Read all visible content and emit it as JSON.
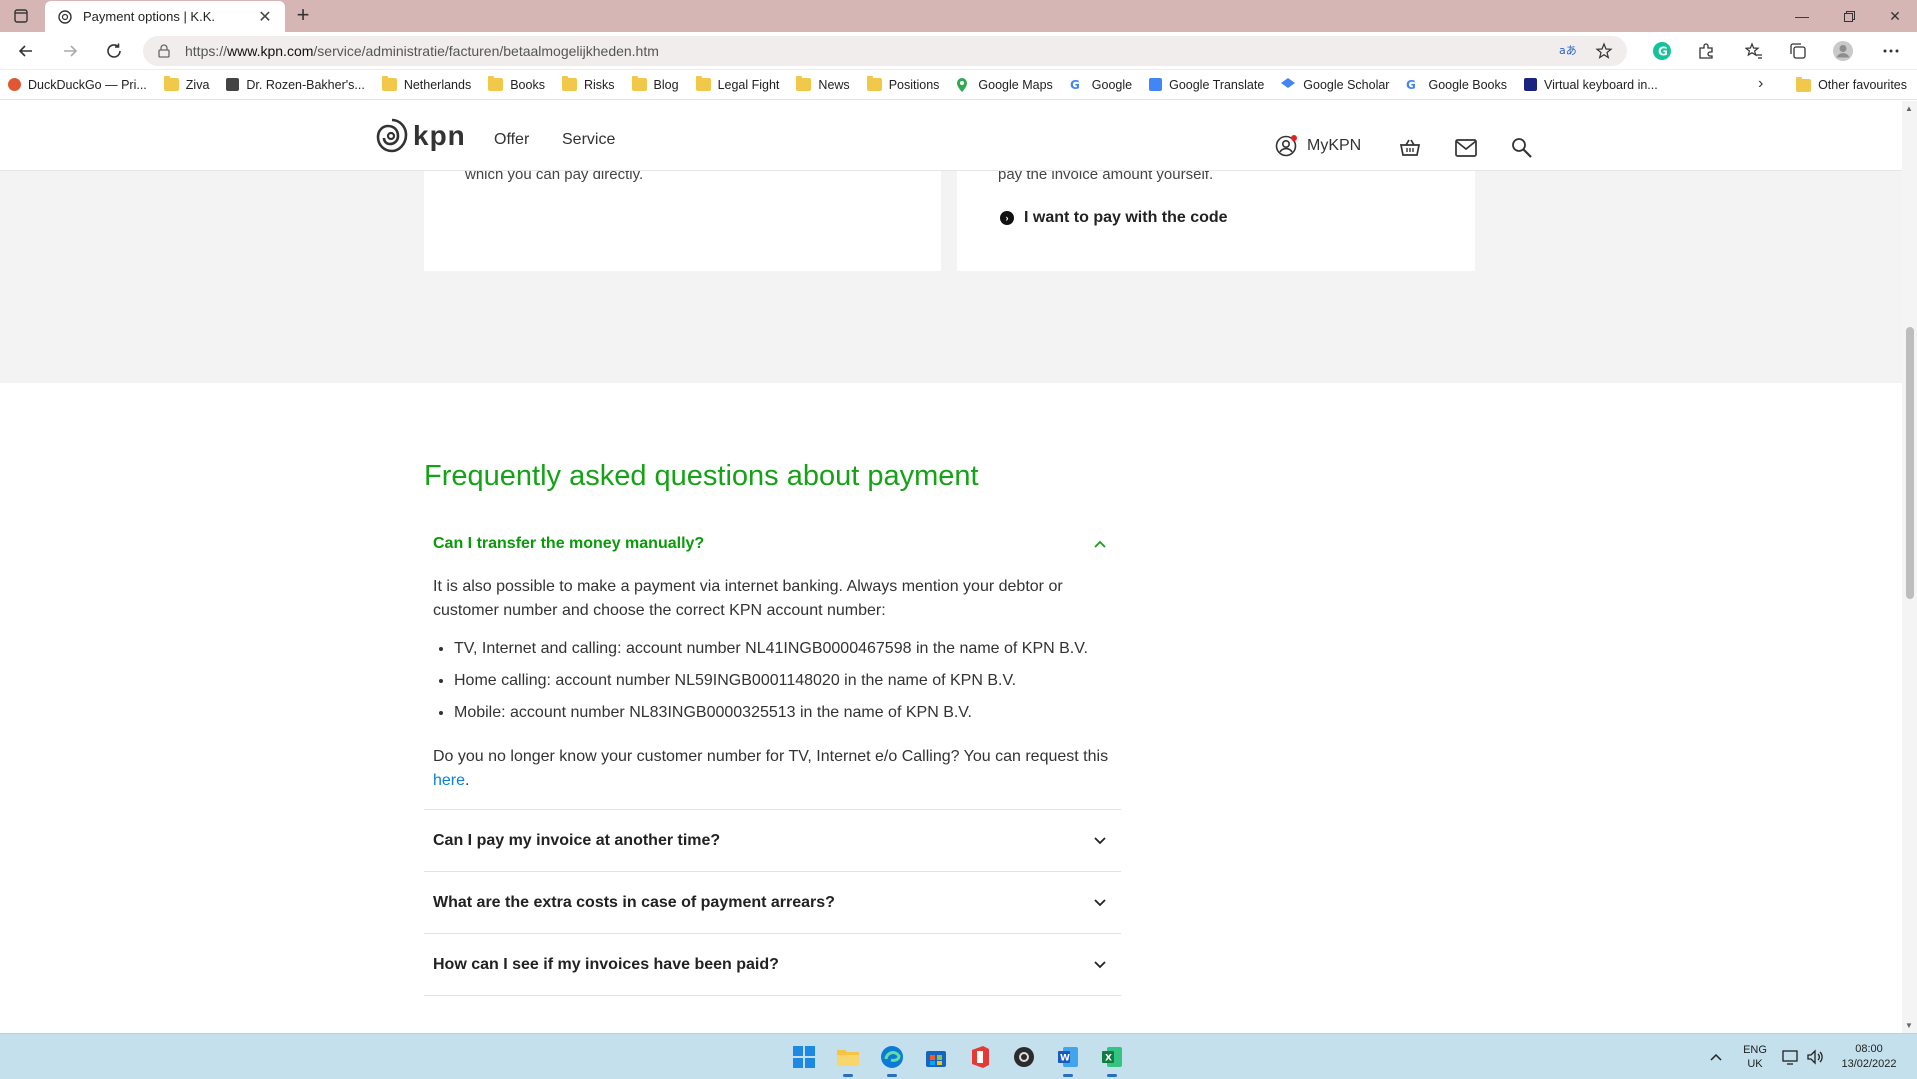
{
  "browser": {
    "tab_title": "Payment options | K.K.",
    "url_prefix": "https://",
    "url_domain": "www.kpn.com",
    "url_path": "/service/administratie/facturen/betaalmogelijkheden.htm",
    "favorites": [
      "DuckDuckGo — Pri...",
      "Ziva",
      "Dr. Rozen-Bakher's...",
      "Netherlands",
      "Books",
      "Risks",
      "Blog",
      "Legal Fight",
      "News",
      "Positions",
      "Google Maps",
      "Google",
      "Google Translate",
      "Google Scholar",
      "Google Books",
      "Virtual keyboard in..."
    ],
    "other_favourites": "Other favourites"
  },
  "site": {
    "logo_text": "kpn",
    "nav": [
      "Offer",
      "Service"
    ],
    "mykpn": "MyKPN"
  },
  "cards": {
    "left_partial_text": "which you can pay directly.",
    "right_partial_text": "pay the invoice amount yourself.",
    "pay_code_link": "I want to pay with the code"
  },
  "faq": {
    "title": "Frequently asked questions about payment",
    "open_question": "Can I transfer the money manually?",
    "answer_intro": "It is also possible to make a payment via internet banking. Always mention your debtor or customer number and choose the correct KPN account number:",
    "accounts": [
      "TV, Internet and calling: account number NL41INGB0000467598 in the name of KPN B.V.",
      "Home calling: account number NL59INGB0001148020 in the name of KPN B.V.",
      "Mobile: account number NL83INGB0000325513 in the name of KPN B.V."
    ],
    "answer_outro": "Do you no longer know your customer number for TV, Internet e/o Calling? You can request this ",
    "answer_link": "here",
    "answer_end": ".",
    "questions": [
      "Can I pay my invoice at another time?",
      "What are the extra costs in case of payment arrears?",
      "How can I see if my invoices have been paid?"
    ]
  },
  "taskbar": {
    "lang_top": "ENG",
    "lang_bottom": "UK",
    "time": "08:00",
    "date": "13/02/2022"
  },
  "colors": {
    "kpn_green": "#16a216",
    "link_blue": "#0b7fd1",
    "tabbar": "#d6b5b5",
    "taskbar": "#c3e0ec"
  }
}
